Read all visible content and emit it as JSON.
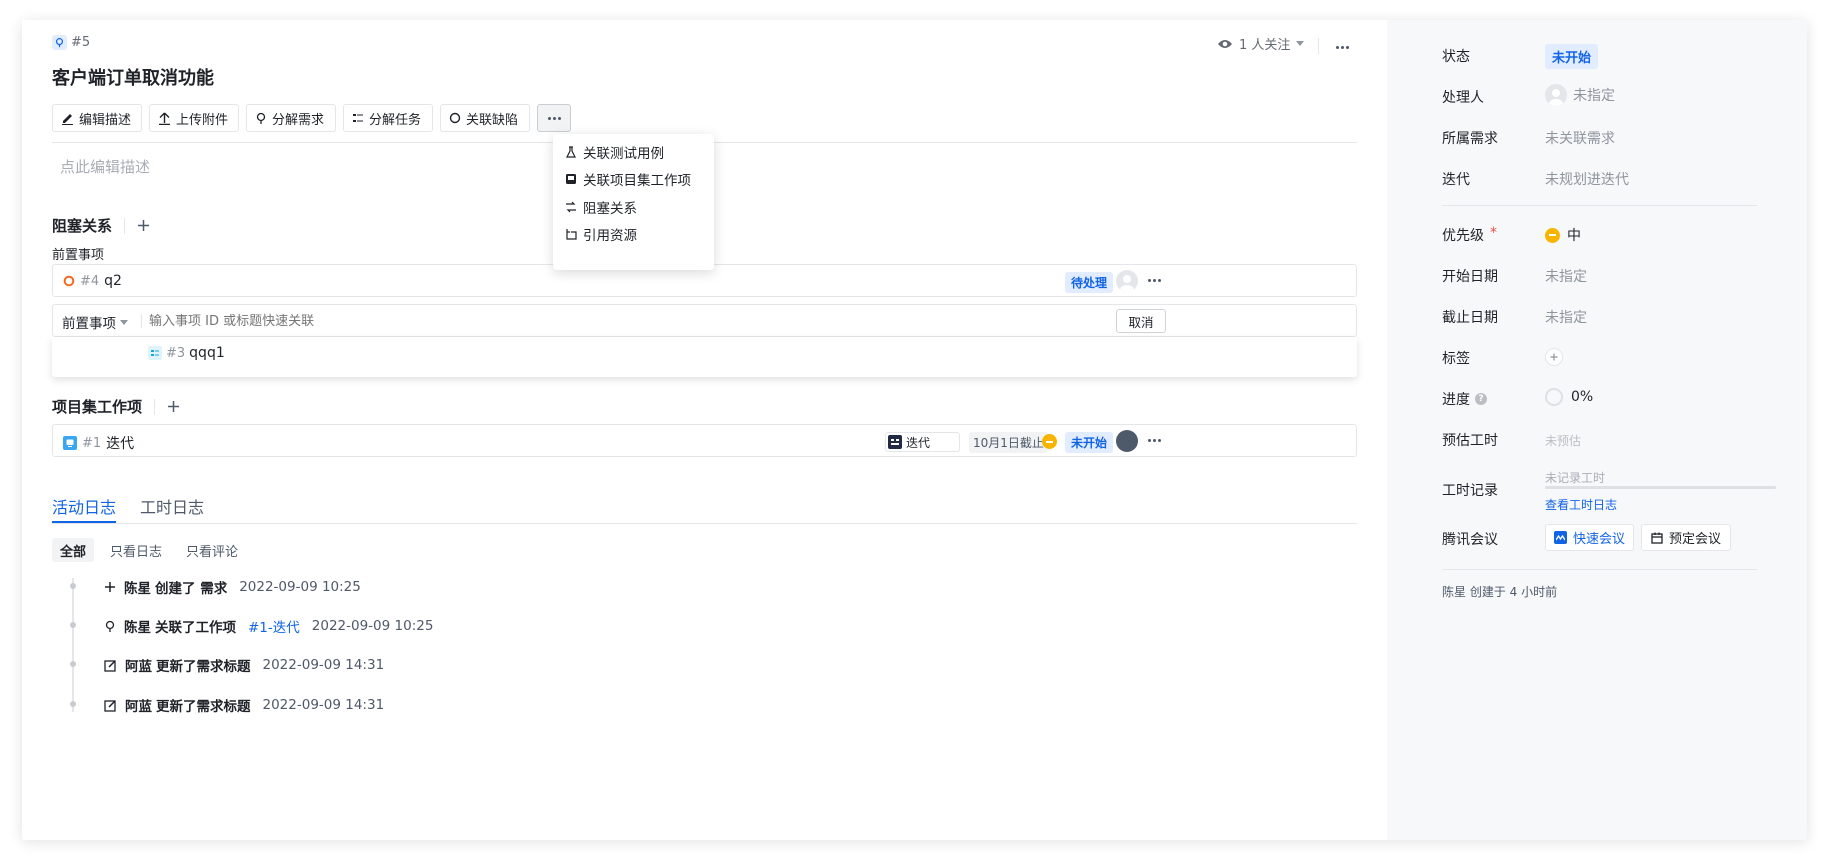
{
  "header": {
    "item_id": "#5",
    "title": "客户端订单取消功能",
    "watchers": "1 人关注"
  },
  "toolbar": {
    "edit_desc": "编辑描述",
    "upload": "上传附件",
    "split_req": "分解需求",
    "split_task": "分解任务",
    "link_bug": "关联缺陷"
  },
  "more_menu": {
    "items": [
      "关联测试用例",
      "关联项目集工作项",
      "阻塞关系",
      "引用资源"
    ]
  },
  "description": {
    "placeholder": "点此编辑描述"
  },
  "blocking": {
    "title": "阻塞关系",
    "sub_title": "前置事项",
    "item": {
      "id": "#4",
      "name": "q2",
      "status": "待处理"
    },
    "search": {
      "type_select": "前置事项",
      "placeholder": "输入事项 ID 或标题快速关联",
      "cancel": "取消"
    },
    "suggestion": {
      "id": "#3",
      "name": "qqq1"
    }
  },
  "program": {
    "title": "项目集工作项",
    "item": {
      "id": "#1",
      "name": "迭代",
      "type": "迭代",
      "due": "10月1日截止",
      "status": "未开始"
    }
  },
  "tabs": {
    "activity": "活动日志",
    "worklog": "工时日志"
  },
  "filters": {
    "all": "全部",
    "logs_only": "只看日志",
    "comments_only": "只看评论"
  },
  "activity": [
    {
      "user": "陈星",
      "action": "创建了 需求",
      "link": "",
      "time": "2022-09-09 10:25"
    },
    {
      "user": "陈星",
      "action": "关联了工作项",
      "link": "#1-迭代",
      "time": "2022-09-09 10:25"
    },
    {
      "user": "阿蓝",
      "action": "更新了需求标题",
      "link": "",
      "time": "2022-09-09 14:31"
    },
    {
      "user": "阿蓝",
      "action": "更新了需求标题",
      "link": "",
      "time": "2022-09-09 14:31"
    }
  ],
  "sidebar": {
    "status_label": "状态",
    "status_value": "未开始",
    "assignee_label": "处理人",
    "assignee_value": "未指定",
    "parent_label": "所属需求",
    "parent_value": "未关联需求",
    "iteration_label": "迭代",
    "iteration_value": "未规划进迭代",
    "priority_label": "优先级",
    "priority_required": "*",
    "priority_value": "中",
    "start_label": "开始日期",
    "start_value": "未指定",
    "due_label": "截止日期",
    "due_value": "未指定",
    "tags_label": "标签",
    "progress_label": "进度",
    "progress_value": "0%",
    "estimate_label": "预估工时",
    "estimate_value": "未预估",
    "worklog_label": "工时记录",
    "worklog_value": "未记录工时",
    "worklog_link": "查看工时日志",
    "meeting_label": "腾讯会议",
    "quick_meeting": "快速会议",
    "book_meeting": "预定会议",
    "footer": "陈星 创建于 4 小时前"
  },
  "colors": {
    "accent": "#1264e6",
    "status_bg": "#e1ecff",
    "priority": "#f7b500",
    "bug_orange": "#f26b21"
  }
}
